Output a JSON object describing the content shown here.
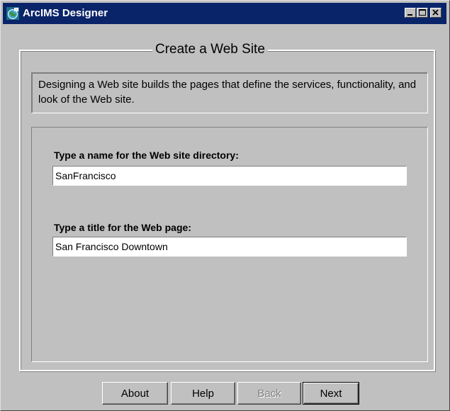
{
  "window": {
    "title": "ArcIMS Designer",
    "title_icon": "arcims-globe-icon"
  },
  "titlebar_controls": {
    "minimize_icon": "minimize-icon",
    "maximize_icon": "maximize-icon",
    "close_icon": "close-icon"
  },
  "panel": {
    "heading": "Create a Web Site",
    "description": "Designing a Web site builds the pages that define the services, functionality, and look of the Web site."
  },
  "form": {
    "directory_label": "Type a name for the Web site directory:",
    "directory_value": "SanFrancisco",
    "title_label": "Type a title for the Web page:",
    "title_value": "San Francisco Downtown"
  },
  "buttons": {
    "about": "About",
    "help": "Help",
    "back": "Back",
    "next": "Next"
  },
  "colors": {
    "titlebar": "#0a246a",
    "window_face": "#c0c0c0"
  }
}
